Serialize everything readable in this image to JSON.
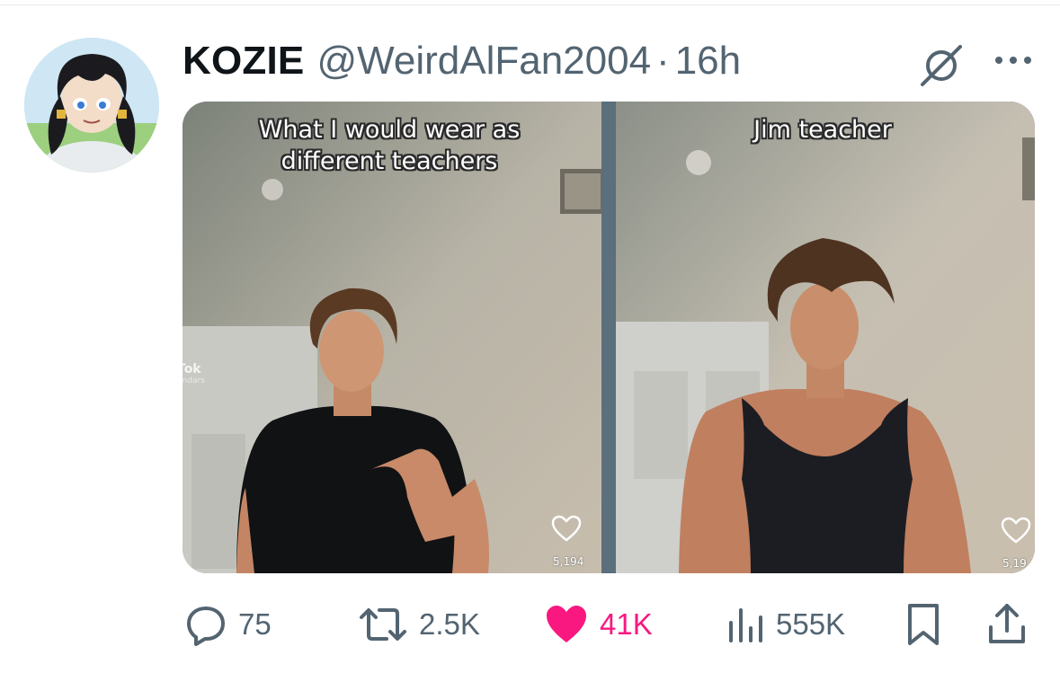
{
  "tweet": {
    "display_name": "KOZIE",
    "handle": "@WeirdAlFan2004",
    "separator": "·",
    "time": "16h"
  },
  "media": {
    "left_caption": "What I would wear as different teachers",
    "right_caption": "Jim teacher",
    "left_like_count": "5,194",
    "right_like_count": "5,19",
    "watermark_main": "Tok",
    "watermark_sub": "endars"
  },
  "actions": {
    "replies": "75",
    "retweets": "2.5K",
    "likes": "41K",
    "views": "555K"
  },
  "colors": {
    "text_primary": "#0f1419",
    "text_secondary": "#536471",
    "like_pink": "#f91880"
  },
  "icons": [
    "grok-icon",
    "more-icon",
    "reply-icon",
    "retweet-icon",
    "heart-icon",
    "views-icon",
    "bookmark-icon",
    "share-icon"
  ]
}
